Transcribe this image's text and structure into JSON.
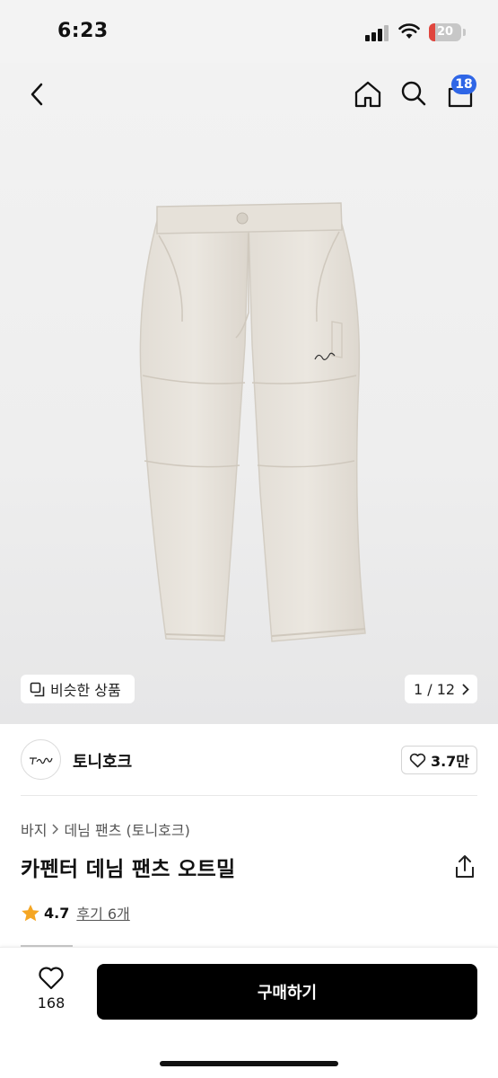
{
  "status_bar": {
    "time": "6:23",
    "battery": "20",
    "battery_level": 0.2,
    "battery_color": "#e0463e"
  },
  "top_nav": {
    "back_icon": "chevron-left-icon",
    "home_icon": "home-icon",
    "search_icon": "search-icon",
    "cart_icon": "shopping-bag-icon",
    "cart_badge": "18",
    "badge_color": "#2f66e6"
  },
  "gallery": {
    "similar_label": "비슷한 상품",
    "counter": "1 / 12"
  },
  "seller": {
    "name": "토니호크",
    "followers": "3.7만"
  },
  "product": {
    "breadcrumb": [
      "바지",
      "데님 팬츠 (토니호크)"
    ],
    "title": "카펜터 데님 팬츠 오트밀",
    "rating": "4.7",
    "reviews": "후기 6개"
  },
  "bottom_bar": {
    "like_count": "168",
    "buy_label": "구매하기"
  }
}
